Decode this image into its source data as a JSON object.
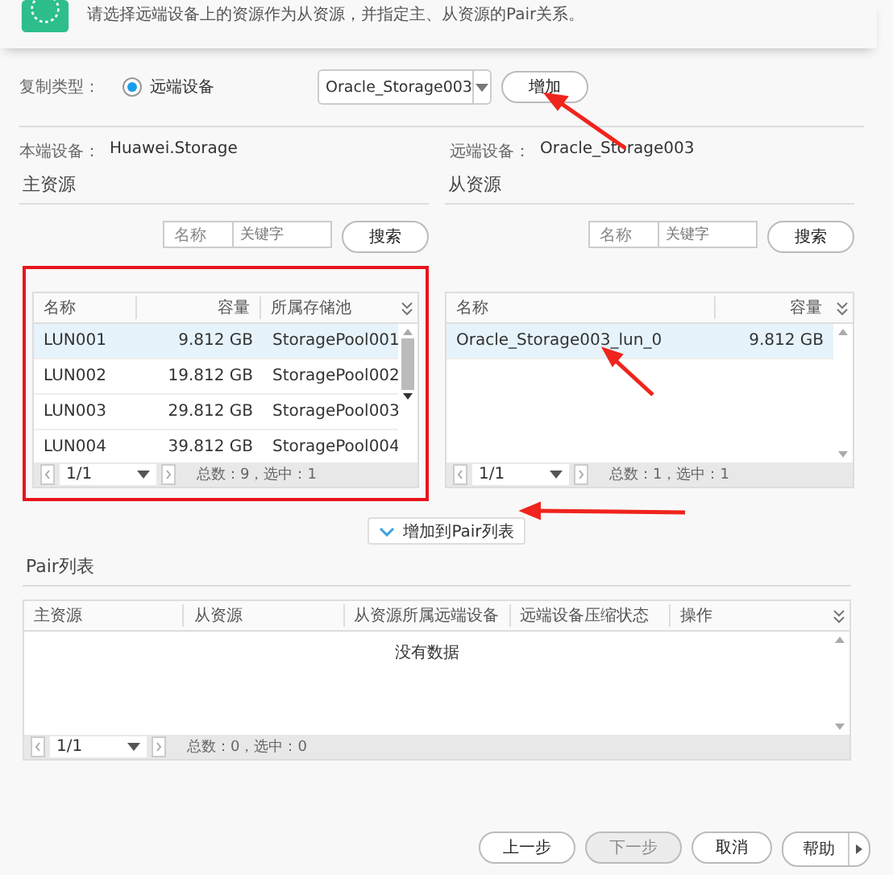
{
  "header": {
    "text": "请选择远端设备上的资源作为从资源，并指定主、从资源的Pair关系。"
  },
  "copy_type": {
    "label": "复制类型：",
    "options": [
      {
        "label": "远端设备",
        "selected": true
      }
    ],
    "device_select": {
      "value": "Oracle_Storage003"
    },
    "add_button": "增加"
  },
  "local_device": {
    "label": "本端设备：",
    "value": "Huawei.Storage"
  },
  "remote_device": {
    "label": "远端设备：",
    "value": "Oracle_Storage003"
  },
  "primary": {
    "title": "主资源",
    "search": {
      "field_label": "名称",
      "placeholder": "关键字",
      "button": "搜索"
    },
    "columns": [
      "名称",
      "容量",
      "所属存储池"
    ],
    "rows": [
      {
        "cells": [
          "LUN001",
          "9.812 GB",
          "StoragePool001"
        ],
        "selected": true
      },
      {
        "cells": [
          "LUN002",
          "19.812 GB",
          "StoragePool002"
        ],
        "selected": false
      },
      {
        "cells": [
          "LUN003",
          "29.812 GB",
          "StoragePool003"
        ],
        "selected": false
      },
      {
        "cells": [
          "LUN004",
          "39.812 GB",
          "StoragePool004"
        ],
        "selected": false
      }
    ],
    "page": "1/1",
    "summary": "总数：9，选中：1"
  },
  "secondary": {
    "title": "从资源",
    "search": {
      "field_label": "名称",
      "placeholder": "关键字",
      "button": "搜索"
    },
    "columns": [
      "名称",
      "容量"
    ],
    "rows": [
      {
        "cells": [
          "Oracle_Storage003_lun_0",
          "9.812 GB"
        ],
        "selected": true
      }
    ],
    "page": "1/1",
    "summary": "总数：1，选中：1"
  },
  "add_to_pair_button": "增加到Pair列表",
  "pair_list": {
    "title": "Pair列表",
    "columns": [
      "主资源",
      "从资源",
      "从资源所属远端设备",
      "远端设备压缩状态",
      "操作"
    ],
    "empty_text": "没有数据",
    "page": "1/1",
    "summary": "总数：0，选中：0"
  },
  "footer_buttons": [
    {
      "label": "上一步",
      "disabled": false
    },
    {
      "label": "下一步",
      "disabled": true
    },
    {
      "label": "取消",
      "disabled": false
    },
    {
      "label": "帮助",
      "disabled": false,
      "kind": "split"
    }
  ]
}
